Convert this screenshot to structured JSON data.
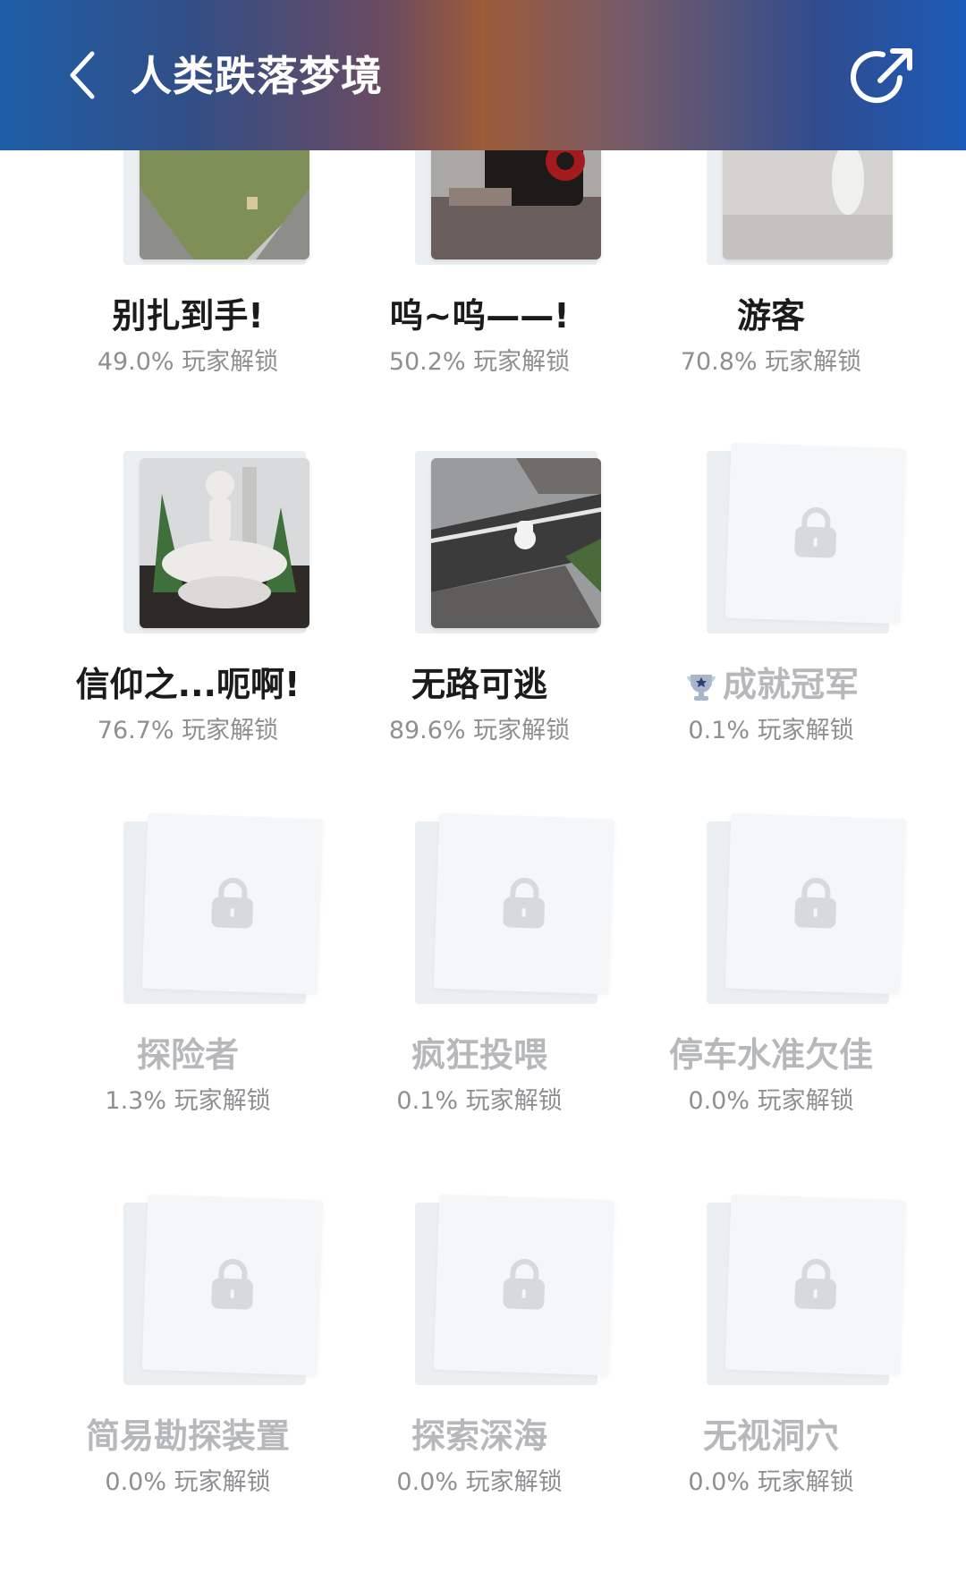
{
  "header": {
    "title": "人类跌落梦境",
    "back_icon": "chevron-left-icon",
    "share_icon": "share-icon"
  },
  "colors": {
    "header_gradient_left": "#1d5fa7",
    "header_gradient_mid": "#9c5b39",
    "header_gradient_right": "#1c5bb7",
    "locked_text": "#b6b8bb",
    "percent_text": "#8e8f92"
  },
  "achievements": [
    {
      "name": "别扎到手!",
      "percent": "49.0% 玩家解锁",
      "locked": false
    },
    {
      "name": "呜~呜——!",
      "percent": "50.2% 玩家解锁",
      "locked": false
    },
    {
      "name": "游客",
      "percent": "70.8% 玩家解锁",
      "locked": false
    },
    {
      "name": "信仰之...呃啊!",
      "percent": "76.7% 玩家解锁",
      "locked": false
    },
    {
      "name": "无路可逃",
      "percent": "89.6% 玩家解锁",
      "locked": false
    },
    {
      "name": "成就冠军",
      "percent": "0.1% 玩家解锁",
      "locked": true,
      "icon": "trophy-icon"
    },
    {
      "name": "探险者",
      "percent": "1.3% 玩家解锁",
      "locked": true
    },
    {
      "name": "疯狂投喂",
      "percent": "0.1% 玩家解锁",
      "locked": true
    },
    {
      "name": "停车水准欠佳",
      "percent": "0.0% 玩家解锁",
      "locked": true
    },
    {
      "name": "简易勘探装置",
      "percent": "0.0% 玩家解锁",
      "locked": true
    },
    {
      "name": "探索深海",
      "percent": "0.0% 玩家解锁",
      "locked": true
    },
    {
      "name": "无视洞穴",
      "percent": "0.0% 玩家解锁",
      "locked": true
    }
  ]
}
